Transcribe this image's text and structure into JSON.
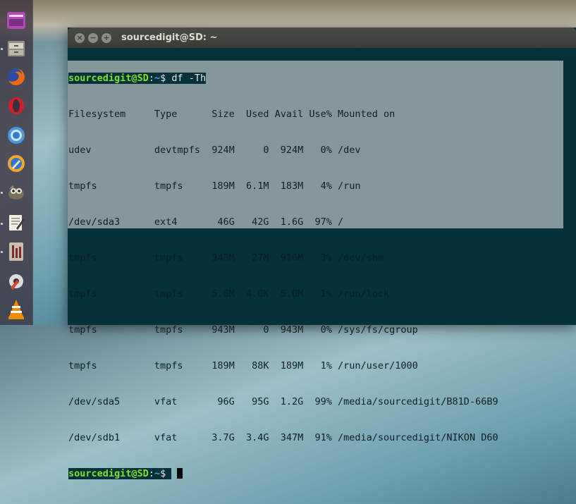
{
  "launcher": {
    "items": [
      {
        "name": "dash-icon",
        "color": "#9b3fa0"
      },
      {
        "name": "files-icon",
        "color": "#8a8a84"
      },
      {
        "name": "firefox-icon",
        "color": "#e66000"
      },
      {
        "name": "opera-icon",
        "color": "#cc1b24"
      },
      {
        "name": "chrome-icon",
        "color": "#3b8ed8"
      },
      {
        "name": "browser-icon",
        "color": "#f2a527"
      },
      {
        "name": "gimp-icon",
        "color": "#6f6552"
      },
      {
        "name": "text-editor-icon",
        "color": "#e8e2c8"
      },
      {
        "name": "system-monitor-icon",
        "color": "#c9b7a6"
      },
      {
        "name": "settings-icon",
        "color": "#d9442c"
      },
      {
        "name": "vlc-icon",
        "color": "#f08c00"
      }
    ]
  },
  "terminal": {
    "title": "sourcedigit@SD: ~",
    "buttons": {
      "close": "×",
      "minimize": "−",
      "maximize": "+"
    },
    "prompt": {
      "user": "sourcedigit@SD",
      "sep": ":",
      "path": "~",
      "dollar": "$ "
    },
    "command": "df -Th",
    "output": [
      "Filesystem     Type      Size  Used Avail Use% Mounted on",
      "udev           devtmpfs  924M     0  924M   0% /dev",
      "tmpfs          tmpfs     189M  6.1M  183M   4% /run",
      "/dev/sda3      ext4       46G   42G  1.6G  97% /",
      "tmpfs          tmpfs     943M   27M  916M   3% /dev/shm",
      "tmpfs          tmpfs     5.0M  4.0K  5.0M   1% /run/lock",
      "tmpfs          tmpfs     943M     0  943M   0% /sys/fs/cgroup",
      "tmpfs          tmpfs     189M   88K  189M   1% /run/user/1000",
      "/dev/sda5      vfat       96G   95G  1.2G  99% /media/sourcedigit/B81D-66B9",
      "/dev/sdb1      vfat      3.7G  3.4G  347M  91% /media/sourcedigit/NIKON D60"
    ]
  }
}
